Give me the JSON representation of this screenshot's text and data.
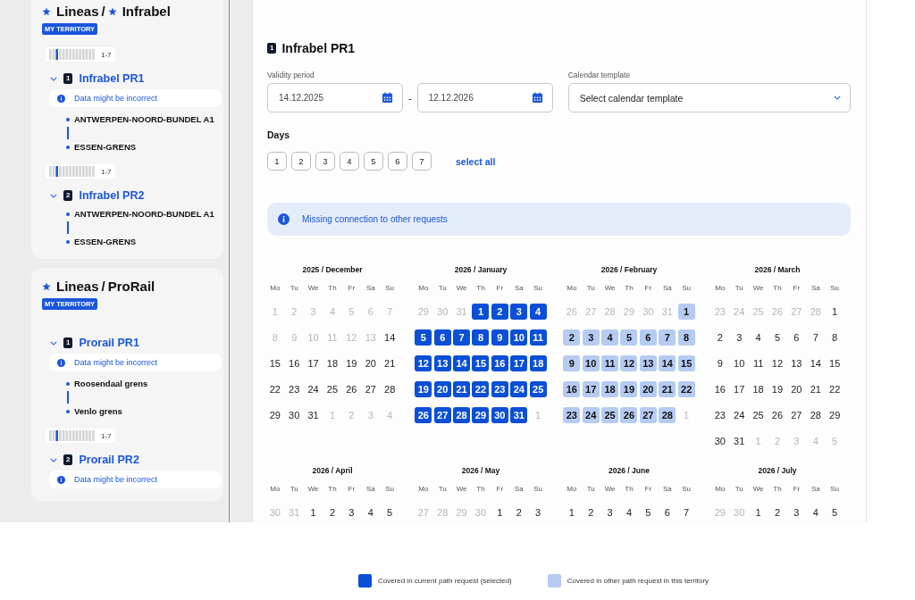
{
  "sidebar": {
    "territories": [
      {
        "operators": [
          {
            "name": "Lineas",
            "starred": true
          },
          {
            "name": "Infrabel",
            "starred": true
          }
        ],
        "separator": "/",
        "badge": "MY TERRITORY",
        "requests": [
          {
            "pattern": "1-7",
            "number": "1",
            "name": "Infrabel PR1",
            "expanded": true,
            "warning": "Data might be incorrect",
            "stops": [
              "ANTWERPEN-NOORD-BUNDEL A1",
              "ESSEN-GRENS"
            ]
          },
          {
            "pattern": "1-7",
            "number": "2",
            "name": "Infrabel PR2",
            "expanded": true,
            "stops": [
              "ANTWERPEN-NOORD-BUNDEL A1",
              "ESSEN-GRENS"
            ]
          }
        ]
      },
      {
        "operators": [
          {
            "name": "Lineas",
            "starred": true
          },
          {
            "name": "ProRail",
            "starred": false
          }
        ],
        "separator": "/",
        "badge": "MY TERRITORY",
        "requests": [
          {
            "number": "1",
            "name": "Prorail PR1",
            "expanded": true,
            "warning": "Data might be incorrect",
            "stops": [
              "Roosendaal grens",
              "Venlo grens"
            ]
          },
          {
            "pattern": "1-7",
            "number": "2",
            "name": "Prorail PR2",
            "expanded": true,
            "warning": "Data might be incorrect"
          }
        ]
      }
    ]
  },
  "main": {
    "number": "1",
    "title": "Infrabel PR1",
    "validity": {
      "label": "Validity period",
      "from": "14.12.2025",
      "separator": "-",
      "to": "12.12.2026"
    },
    "template": {
      "label": "Calendar template",
      "placeholder": "Select calendar template"
    },
    "days": {
      "label": "Days",
      "items": [
        {
          "label": "1",
          "selected": false
        },
        {
          "label": "2",
          "selected": false
        },
        {
          "label": "3",
          "selected": false
        },
        {
          "label": "4",
          "selected": false
        },
        {
          "label": "5",
          "selected": false
        },
        {
          "label": "6",
          "selected": false
        },
        {
          "label": "7",
          "selected": false
        }
      ],
      "select_all": "select all"
    },
    "banner": "Missing connection to other requests",
    "months": [
      {
        "title": "2025 / December",
        "weekdays": [
          "Mo",
          "Tu",
          "We",
          "Th",
          "Fr",
          "Sa",
          "Su"
        ],
        "weeks": [
          [
            {
              "d": "1",
              "kind": "out"
            },
            {
              "d": "2",
              "kind": "out"
            },
            {
              "d": "3",
              "kind": "out"
            },
            {
              "d": "4",
              "kind": "out"
            },
            {
              "d": "5",
              "kind": "out"
            },
            {
              "d": "6",
              "kind": "out"
            },
            {
              "d": "7",
              "kind": "out"
            }
          ],
          [
            {
              "d": "8",
              "kind": "out"
            },
            {
              "d": "9",
              "kind": "out"
            },
            {
              "d": "10",
              "kind": "out"
            },
            {
              "d": "11",
              "kind": "out"
            },
            {
              "d": "12",
              "kind": "out"
            },
            {
              "d": "13",
              "kind": "out"
            },
            {
              "d": "14",
              "kind": "plain"
            }
          ],
          [
            {
              "d": "15",
              "kind": "plain"
            },
            {
              "d": "16",
              "kind": "plain"
            },
            {
              "d": "17",
              "kind": "plain"
            },
            {
              "d": "18",
              "kind": "plain"
            },
            {
              "d": "19",
              "kind": "plain"
            },
            {
              "d": "20",
              "kind": "plain"
            },
            {
              "d": "21",
              "kind": "plain"
            }
          ],
          [
            {
              "d": "22",
              "kind": "plain"
            },
            {
              "d": "23",
              "kind": "plain"
            },
            {
              "d": "24",
              "kind": "plain"
            },
            {
              "d": "25",
              "kind": "plain"
            },
            {
              "d": "26",
              "kind": "plain"
            },
            {
              "d": "27",
              "kind": "plain"
            },
            {
              "d": "28",
              "kind": "plain"
            }
          ],
          [
            {
              "d": "29",
              "kind": "plain"
            },
            {
              "d": "30",
              "kind": "plain"
            },
            {
              "d": "31",
              "kind": "plain"
            },
            {
              "d": "1",
              "kind": "out"
            },
            {
              "d": "2",
              "kind": "out"
            },
            {
              "d": "3",
              "kind": "out"
            },
            {
              "d": "4",
              "kind": "out"
            }
          ]
        ]
      },
      {
        "title": "2026 / January",
        "weekdays": [
          "Mo",
          "Tu",
          "We",
          "Th",
          "Fr",
          "Sa",
          "Su"
        ],
        "weeks": [
          [
            {
              "d": "29",
              "kind": "out"
            },
            {
              "d": "30",
              "kind": "out"
            },
            {
              "d": "31",
              "kind": "out"
            },
            {
              "d": "1",
              "kind": "current"
            },
            {
              "d": "2",
              "kind": "current"
            },
            {
              "d": "3",
              "kind": "current"
            },
            {
              "d": "4",
              "kind": "current"
            }
          ],
          [
            {
              "d": "5",
              "kind": "current"
            },
            {
              "d": "6",
              "kind": "current"
            },
            {
              "d": "7",
              "kind": "current"
            },
            {
              "d": "8",
              "kind": "current"
            },
            {
              "d": "9",
              "kind": "current"
            },
            {
              "d": "10",
              "kind": "current"
            },
            {
              "d": "11",
              "kind": "current"
            }
          ],
          [
            {
              "d": "12",
              "kind": "current"
            },
            {
              "d": "13",
              "kind": "current"
            },
            {
              "d": "14",
              "kind": "current"
            },
            {
              "d": "15",
              "kind": "current"
            },
            {
              "d": "16",
              "kind": "current"
            },
            {
              "d": "17",
              "kind": "current"
            },
            {
              "d": "18",
              "kind": "current"
            }
          ],
          [
            {
              "d": "19",
              "kind": "current"
            },
            {
              "d": "20",
              "kind": "current"
            },
            {
              "d": "21",
              "kind": "current"
            },
            {
              "d": "22",
              "kind": "current"
            },
            {
              "d": "23",
              "kind": "current"
            },
            {
              "d": "24",
              "kind": "current"
            },
            {
              "d": "25",
              "kind": "current"
            }
          ],
          [
            {
              "d": "26",
              "kind": "current"
            },
            {
              "d": "27",
              "kind": "current"
            },
            {
              "d": "28",
              "kind": "current"
            },
            {
              "d": "29",
              "kind": "current"
            },
            {
              "d": "30",
              "kind": "current"
            },
            {
              "d": "31",
              "kind": "current"
            },
            {
              "d": "1",
              "kind": "out"
            }
          ]
        ]
      },
      {
        "title": "2026 / February",
        "weekdays": [
          "Mo",
          "Tu",
          "We",
          "Th",
          "Fr",
          "Sa",
          "Su"
        ],
        "weeks": [
          [
            {
              "d": "26",
              "kind": "out"
            },
            {
              "d": "27",
              "kind": "out"
            },
            {
              "d": "28",
              "kind": "out"
            },
            {
              "d": "29",
              "kind": "out"
            },
            {
              "d": "30",
              "kind": "out"
            },
            {
              "d": "31",
              "kind": "out"
            },
            {
              "d": "1",
              "kind": "territory"
            }
          ],
          [
            {
              "d": "2",
              "kind": "territory"
            },
            {
              "d": "3",
              "kind": "territory"
            },
            {
              "d": "4",
              "kind": "territory"
            },
            {
              "d": "5",
              "kind": "territory"
            },
            {
              "d": "6",
              "kind": "territory"
            },
            {
              "d": "7",
              "kind": "territory"
            },
            {
              "d": "8",
              "kind": "territory"
            }
          ],
          [
            {
              "d": "9",
              "kind": "territory"
            },
            {
              "d": "10",
              "kind": "territory"
            },
            {
              "d": "11",
              "kind": "territory"
            },
            {
              "d": "12",
              "kind": "territory"
            },
            {
              "d": "13",
              "kind": "territory"
            },
            {
              "d": "14",
              "kind": "territory"
            },
            {
              "d": "15",
              "kind": "territory"
            }
          ],
          [
            {
              "d": "16",
              "kind": "territory"
            },
            {
              "d": "17",
              "kind": "territory"
            },
            {
              "d": "18",
              "kind": "territory"
            },
            {
              "d": "19",
              "kind": "territory"
            },
            {
              "d": "20",
              "kind": "territory"
            },
            {
              "d": "21",
              "kind": "territory"
            },
            {
              "d": "22",
              "kind": "territory"
            }
          ],
          [
            {
              "d": "23",
              "kind": "territory"
            },
            {
              "d": "24",
              "kind": "territory"
            },
            {
              "d": "25",
              "kind": "territory"
            },
            {
              "d": "26",
              "kind": "territory"
            },
            {
              "d": "27",
              "kind": "territory"
            },
            {
              "d": "28",
              "kind": "territory"
            },
            {
              "d": "1",
              "kind": "out"
            }
          ]
        ]
      },
      {
        "title": "2026 / March",
        "weekdays": [
          "Mo",
          "Tu",
          "We",
          "Th",
          "Fr",
          "Sa",
          "Su"
        ],
        "weeks": [
          [
            {
              "d": "23",
              "kind": "out"
            },
            {
              "d": "24",
              "kind": "out"
            },
            {
              "d": "25",
              "kind": "out"
            },
            {
              "d": "26",
              "kind": "out"
            },
            {
              "d": "27",
              "kind": "out"
            },
            {
              "d": "28",
              "kind": "out"
            },
            {
              "d": "1",
              "kind": "plain"
            }
          ],
          [
            {
              "d": "2",
              "kind": "plain"
            },
            {
              "d": "3",
              "kind": "plain"
            },
            {
              "d": "4",
              "kind": "plain"
            },
            {
              "d": "5",
              "kind": "plain"
            },
            {
              "d": "6",
              "kind": "plain"
            },
            {
              "d": "7",
              "kind": "plain"
            },
            {
              "d": "8",
              "kind": "plain"
            }
          ],
          [
            {
              "d": "9",
              "kind": "plain"
            },
            {
              "d": "10",
              "kind": "plain"
            },
            {
              "d": "11",
              "kind": "plain"
            },
            {
              "d": "12",
              "kind": "plain"
            },
            {
              "d": "13",
              "kind": "plain"
            },
            {
              "d": "14",
              "kind": "plain"
            },
            {
              "d": "15",
              "kind": "plain"
            }
          ],
          [
            {
              "d": "16",
              "kind": "plain"
            },
            {
              "d": "17",
              "kind": "plain"
            },
            {
              "d": "18",
              "kind": "plain"
            },
            {
              "d": "19",
              "kind": "plain"
            },
            {
              "d": "20",
              "kind": "plain"
            },
            {
              "d": "21",
              "kind": "plain"
            },
            {
              "d": "22",
              "kind": "plain"
            }
          ],
          [
            {
              "d": "23",
              "kind": "plain"
            },
            {
              "d": "24",
              "kind": "plain"
            },
            {
              "d": "25",
              "kind": "plain"
            },
            {
              "d": "26",
              "kind": "plain"
            },
            {
              "d": "27",
              "kind": "plain"
            },
            {
              "d": "28",
              "kind": "plain"
            },
            {
              "d": "29",
              "kind": "plain"
            }
          ],
          [
            {
              "d": "30",
              "kind": "plain"
            },
            {
              "d": "31",
              "kind": "plain"
            },
            {
              "d": "1",
              "kind": "out"
            },
            {
              "d": "2",
              "kind": "out"
            },
            {
              "d": "3",
              "kind": "out"
            },
            {
              "d": "4",
              "kind": "out"
            },
            {
              "d": "5",
              "kind": "out"
            }
          ]
        ]
      },
      {
        "title": "2026 / April",
        "weekdays": [
          "Mo",
          "Tu",
          "We",
          "Th",
          "Fr",
          "Sa",
          "Su"
        ],
        "weeks": [
          [
            {
              "d": "30",
              "kind": "out"
            },
            {
              "d": "31",
              "kind": "out"
            },
            {
              "d": "1",
              "kind": "plain"
            },
            {
              "d": "2",
              "kind": "plain"
            },
            {
              "d": "3",
              "kind": "plain"
            },
            {
              "d": "4",
              "kind": "plain"
            },
            {
              "d": "5",
              "kind": "plain"
            }
          ]
        ]
      },
      {
        "title": "2026 / May",
        "weekdays": [
          "Mo",
          "Tu",
          "We",
          "Th",
          "Fr",
          "Sa",
          "Su"
        ],
        "weeks": [
          [
            {
              "d": "27",
              "kind": "out"
            },
            {
              "d": "28",
              "kind": "out"
            },
            {
              "d": "29",
              "kind": "out"
            },
            {
              "d": "30",
              "kind": "out"
            },
            {
              "d": "1",
              "kind": "plain"
            },
            {
              "d": "2",
              "kind": "plain"
            },
            {
              "d": "3",
              "kind": "plain"
            }
          ]
        ]
      },
      {
        "title": "2026 / June",
        "weekdays": [
          "Mo",
          "Tu",
          "We",
          "Th",
          "Fr",
          "Sa",
          "Su"
        ],
        "weeks": [
          [
            {
              "d": "1",
              "kind": "plain"
            },
            {
              "d": "2",
              "kind": "plain"
            },
            {
              "d": "3",
              "kind": "plain"
            },
            {
              "d": "4",
              "kind": "plain"
            },
            {
              "d": "5",
              "kind": "plain"
            },
            {
              "d": "6",
              "kind": "plain"
            },
            {
              "d": "7",
              "kind": "plain"
            }
          ]
        ]
      },
      {
        "title": "2026 / July",
        "weekdays": [
          "Mo",
          "Tu",
          "We",
          "Th",
          "Fr",
          "Sa",
          "Su"
        ],
        "weeks": [
          [
            {
              "d": "29",
              "kind": "out"
            },
            {
              "d": "30",
              "kind": "out"
            },
            {
              "d": "1",
              "kind": "plain"
            },
            {
              "d": "2",
              "kind": "plain"
            },
            {
              "d": "3",
              "kind": "plain"
            },
            {
              "d": "4",
              "kind": "plain"
            },
            {
              "d": "5",
              "kind": "plain"
            }
          ]
        ]
      }
    ]
  },
  "legend": [
    {
      "label": "Covered in current path request (selected)",
      "color": "#0b4fd6"
    },
    {
      "label": "Covered in other path request in this territory",
      "color": "#b5cbf2"
    }
  ]
}
